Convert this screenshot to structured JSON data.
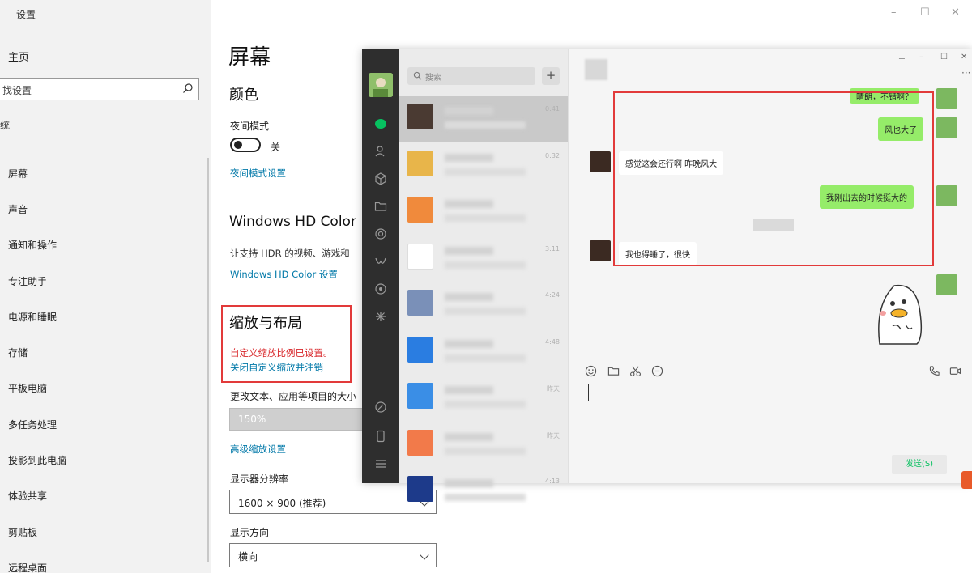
{
  "settings": {
    "window_title": "设置",
    "home": "主页",
    "search_placeholder": "找设置",
    "category": "统",
    "nav": [
      "屏幕",
      "声音",
      "通知和操作",
      "专注助手",
      "电源和睡眠",
      "存储",
      "平板电脑",
      "多任务处理",
      "投影到此电脑",
      "体验共享",
      "剪贴板",
      "远程桌面"
    ],
    "page_title": "屏幕",
    "color_heading": "颜色",
    "night_mode_label": "夜间模式",
    "night_mode_state": "关",
    "night_mode_settings_link": "夜间模式设置",
    "hdr_heading": "Windows HD Color",
    "hdr_desc": "让支持 HDR 的视频、游戏和",
    "hdr_link": "Windows HD Color 设置",
    "scale_heading": "缩放与布局",
    "scale_warning": "自定义缩放比例已设置。",
    "scale_signout_link": "关闭自定义缩放并注销",
    "text_size_label": "更改文本、应用等项目的大小",
    "scale_value": "150%",
    "advanced_scale_link": "高级缩放设置",
    "resolution_label": "显示器分辨率",
    "resolution_value": "1600 × 900 (推荐)",
    "orientation_label": "显示方向",
    "orientation_value": "横向",
    "window_controls": {
      "minimize": "–",
      "maximize": "☐",
      "close": "✕"
    }
  },
  "wechat": {
    "search_placeholder": "搜索",
    "add_label": "+",
    "conversations": [
      {
        "time": "0:41",
        "color": "#4a3a32",
        "selected": true
      },
      {
        "time": "0:32",
        "color": "#e8b54a",
        "selected": false
      },
      {
        "time": "",
        "color": "#f08a3c",
        "selected": false
      },
      {
        "time": "3:11",
        "color": "#ffffff",
        "selected": false
      },
      {
        "time": "4:24",
        "color": "#7a90b8",
        "selected": false
      },
      {
        "time": "4:48",
        "color": "#2a7de1",
        "selected": false
      },
      {
        "time": "昨天",
        "color": "#3a8ee6",
        "selected": false
      },
      {
        "time": "昨天",
        "color": "#f27a4a",
        "selected": false
      },
      {
        "time": "4:13",
        "color": "#1d3a8a",
        "selected": false
      }
    ],
    "chat_controls": {
      "pin": "⊥",
      "minimize": "–",
      "maximize": "☐",
      "close": "✕",
      "more": "···"
    },
    "messages": {
      "m1": "晴朗，不错啊？",
      "m2": "风也大了",
      "m3": "感觉这会还行啊 昨晚风大",
      "m4": "我刚出去的时候挺大的",
      "m5": "我也得睡了，很快"
    },
    "send_label": "发送(S)"
  }
}
